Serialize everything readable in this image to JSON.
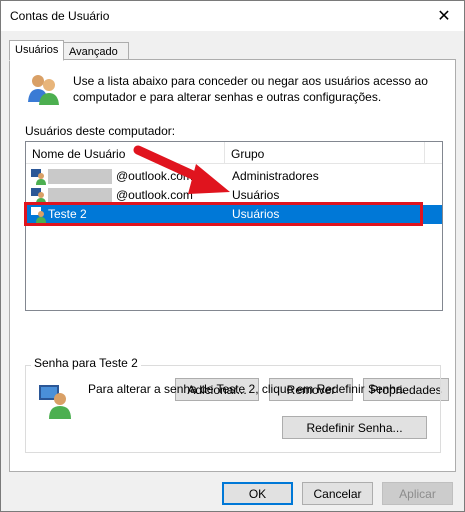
{
  "window": {
    "title": "Contas de Usuário",
    "close_glyph": "✕"
  },
  "tabs": [
    {
      "label": "Usuários",
      "active": true
    },
    {
      "label": "Avançado",
      "active": false
    }
  ],
  "intro": {
    "text": "Use a lista abaixo para conceder ou negar aos usuários acesso ao computador e para alterar senhas e outras configurações."
  },
  "users_section": {
    "label": "Usuários deste computador:",
    "columns": [
      "Nome de Usuário",
      "Grupo"
    ],
    "rows": [
      {
        "name": "@outlook.com",
        "group": "Administradores",
        "selected": false
      },
      {
        "name": "@outlook.com",
        "group": "Usuários",
        "selected": false
      },
      {
        "name": "Teste 2",
        "group": "Usuários",
        "selected": true
      }
    ]
  },
  "actions": {
    "add": "Adicionar...",
    "remove": "Remover",
    "properties": "Propriedades"
  },
  "password": {
    "group_title": "Senha para Teste 2",
    "text": "Para alterar a senha de Teste 2, clique em Redefinir Senha.",
    "reset_button": "Redefinir Senha..."
  },
  "footer": {
    "ok": "OK",
    "cancel": "Cancelar",
    "apply": "Aplicar"
  },
  "colors": {
    "selection": "#0078d7",
    "annotation": "#e0141e",
    "apply_disabled_text": "#8c8c8c"
  },
  "icons": {
    "users": "users-icon",
    "user_row": "user-icon",
    "close": "close-icon",
    "arrow": "annotation-arrow-icon"
  }
}
